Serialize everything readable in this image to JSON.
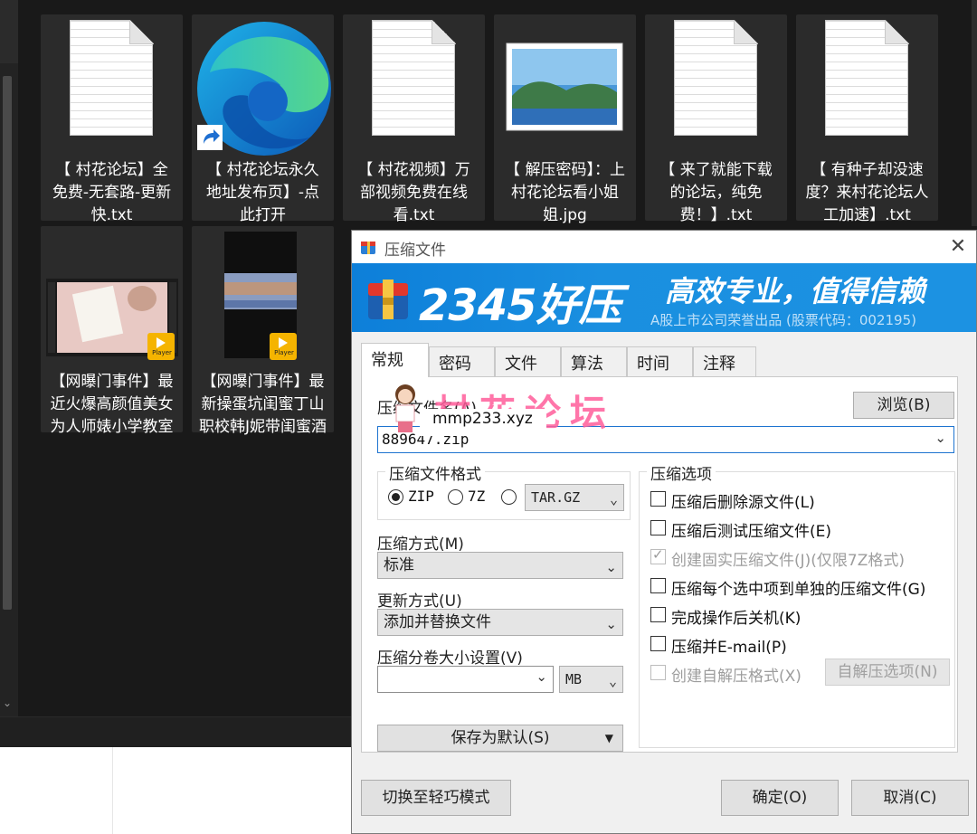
{
  "explorer": {
    "files": [
      {
        "name": "【 村花论坛】全免费-无套路-更新快.txt",
        "kind": "text"
      },
      {
        "name": "【 村花论坛永久地址发布页】-点此打开",
        "kind": "edge-shortcut"
      },
      {
        "name": "【 村花视频】万部视频免费在线看.txt",
        "kind": "text"
      },
      {
        "name": "【 解压密码】：上村花论坛看小姐姐.jpg",
        "kind": "image"
      },
      {
        "name": "【 来了就能下载的论坛，纯免费！】.txt",
        "kind": "text"
      },
      {
        "name": "【 有种子却没速度？来村花论坛人工加速】.txt",
        "kind": "text"
      },
      {
        "name": "【网曝门事件】最近火爆高颜值美女为人师婊小学教室『李雪...",
        "kind": "video"
      },
      {
        "name": "【网曝门事件】最新操蛋坑闺蜜丁山职校韩J妮带闺蜜酒店约炮...",
        "kind": "video"
      }
    ],
    "player_badge": "Player"
  },
  "dialog": {
    "title": "压缩文件",
    "close_icon": "close-icon",
    "banner": {
      "brand": "2345好压",
      "slogan": "高效专业，值得信赖",
      "subtext": "A股上市公司荣誉出品 (股票代码：002195)"
    },
    "tabs": [
      "常规",
      "密码",
      "文件",
      "算法",
      "时间",
      "注释"
    ],
    "active_tab": 0,
    "archive_name_label": "压缩文件名(A)",
    "browse_button": "浏览(B)",
    "archive_name_value": "889647.zip",
    "format_group": {
      "title": "压缩文件格式",
      "options": [
        "ZIP",
        "7Z"
      ],
      "selected": "ZIP",
      "other_select": "TAR.GZ"
    },
    "method_label": "压缩方式(M)",
    "method_value": "标准",
    "update_label": "更新方式(U)",
    "update_value": "添加并替换文件",
    "split_label": "压缩分卷大小设置(V)",
    "split_value": "",
    "split_unit": "MB",
    "save_default_button": "保存为默认(S)",
    "options_group": {
      "title": "压缩选项",
      "items": [
        {
          "label": "压缩后删除源文件(L)",
          "checked": false,
          "enabled": true
        },
        {
          "label": "压缩后测试压缩文件(E)",
          "checked": false,
          "enabled": true
        },
        {
          "label": "创建固实压缩文件(J)(仅限7Z格式)",
          "checked": true,
          "enabled": false
        },
        {
          "label": "压缩每个选中项到单独的压缩文件(G)",
          "checked": false,
          "enabled": true
        },
        {
          "label": "完成操作后关机(K)",
          "checked": false,
          "enabled": true
        },
        {
          "label": "压缩并E-mail(P)",
          "checked": false,
          "enabled": true
        },
        {
          "label": "创建自解压格式(X)",
          "checked": false,
          "enabled": false
        }
      ],
      "sfx_button": "自解压选项(N)"
    },
    "light_mode_button": "切换至轻巧模式",
    "ok_button": "确定(O)",
    "cancel_button": "取消(C)"
  },
  "watermark": {
    "text": "村花论坛",
    "url": "mmp233.xyz"
  }
}
